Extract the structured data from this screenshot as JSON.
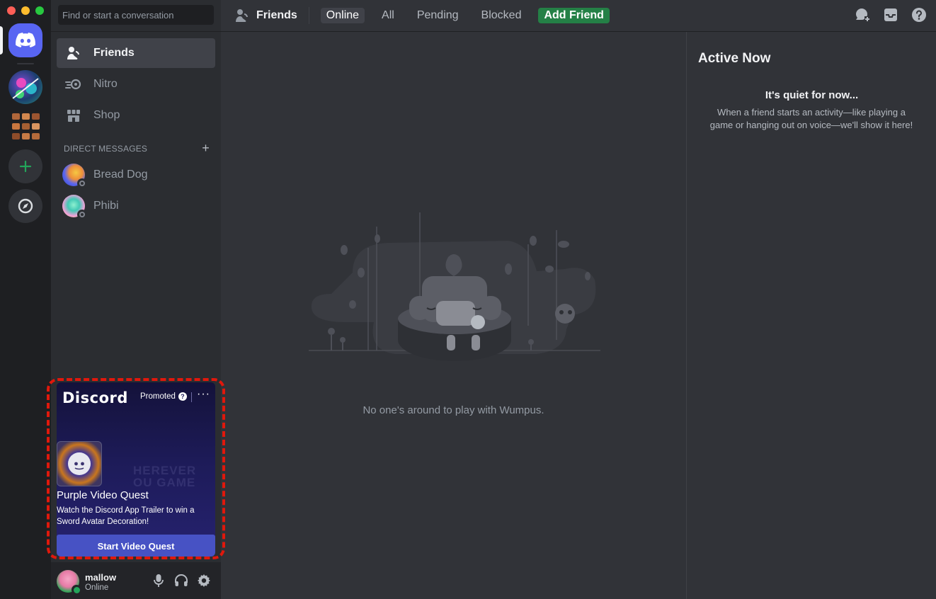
{
  "window": {
    "traffic_lights": [
      "#ff5f57",
      "#febc2e",
      "#28c840"
    ]
  },
  "rail": {
    "items": [
      {
        "name": "home",
        "icon": "discord-logo-icon"
      },
      {
        "name": "server-1",
        "icon": "server-avatar"
      },
      {
        "name": "server-2",
        "icon": "server-avatar"
      },
      {
        "name": "add-server",
        "icon": "plus-icon"
      },
      {
        "name": "explore",
        "icon": "compass-icon"
      }
    ]
  },
  "sidebar": {
    "search_placeholder": "Find or start a conversation",
    "nav": [
      {
        "label": "Friends",
        "icon": "friends-icon",
        "active": true
      },
      {
        "label": "Nitro",
        "icon": "nitro-icon",
        "active": false
      },
      {
        "label": "Shop",
        "icon": "shop-icon",
        "active": false
      }
    ],
    "dm_header": "DIRECT MESSAGES",
    "dms": [
      {
        "name": "Bread Dog"
      },
      {
        "name": "Phibi"
      }
    ]
  },
  "promo": {
    "brand": "Discord",
    "promoted": "Promoted",
    "more": "···",
    "title": "Purple Video Quest",
    "description": "Watch the Discord App Trailer to win a Sword Avatar Decoration!",
    "button": "Start Video Quest"
  },
  "user": {
    "name": "mallow",
    "status": "Online"
  },
  "topbar": {
    "title": "Friends",
    "tabs": [
      "Online",
      "All",
      "Pending",
      "Blocked"
    ],
    "selected_tab": "Online",
    "add_friend": "Add Friend"
  },
  "main": {
    "empty_text": "No one's around to play with Wumpus."
  },
  "active_now": {
    "title": "Active Now",
    "quiet_title": "It's quiet for now...",
    "quiet_desc": "When a friend starts an activity—like playing a game or hanging out on voice—we'll show it here!"
  },
  "colors": {
    "brand": "#5865f2",
    "add_friend_green": "#248046",
    "online_green": "#23a55a",
    "highlight_red": "#e0180c"
  }
}
